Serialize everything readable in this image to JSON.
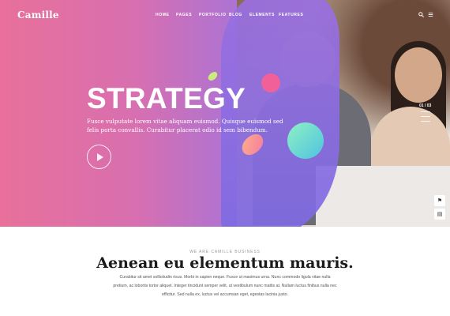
{
  "brand": {
    "logo": "Camille"
  },
  "nav": {
    "items": [
      "HOME",
      "PAGES",
      "PORTFOLIO",
      "BLOG",
      "ELEMENTS",
      "FEATURES"
    ]
  },
  "header_icons": [
    "search-icon",
    "menu-icon"
  ],
  "hero": {
    "headline": "STRATEGY",
    "subtitle": "Fusce vulputate lorem vitae aliquam euismod. Quisque euismod sed felis porta convallis. Curabitur placerat odio id sem bibendum.",
    "play_icon": "play-icon",
    "slide_counter": "01 / 03"
  },
  "side_buttons": [
    "flag-icon",
    "layout-icon"
  ],
  "about": {
    "eyebrow": "WE ARE CAMILLE BUSINESS",
    "title": "Aenean eu elementum mauris.",
    "body": "Curabitur sit amet sollicitudin risus. Morbi in sapien neque. Fusce ut maximus urna. Nunc commodo ligula vitae nulla pretium, ac lobortis tortor aliquet. Integer tincidunt semper velit, ut vestibulum nunc mattis at. Nullam luctus finibus nulla nec efficitur. Sed nulla ex, luctus vel accumsan eget, egestas lacinia justo."
  },
  "colors": {
    "hero_gradient_start": "#e8709a",
    "hero_gradient_mid": "#a774d8",
    "accent_pink": "#f2609a",
    "accent_teal": "#4fc3e0",
    "text_dark": "#1b1b1b"
  }
}
